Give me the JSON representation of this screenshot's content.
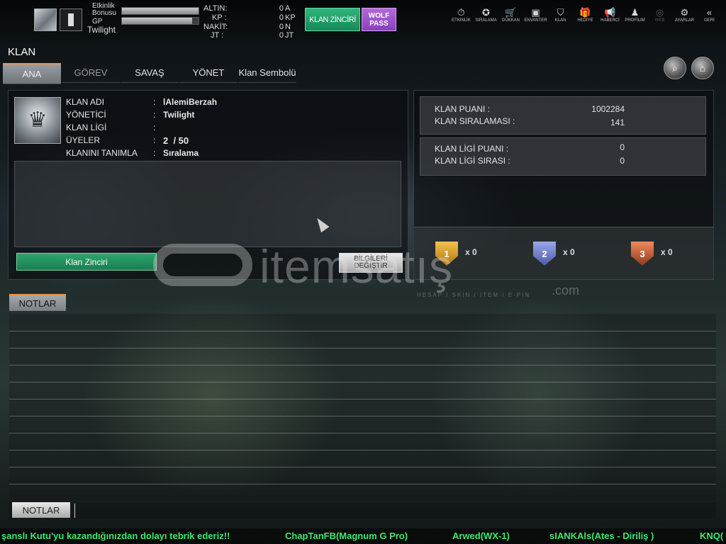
{
  "topbar": {
    "event_bonus_label": "Etkinlik Bonusu",
    "gp_label": "GP",
    "username": "Twilight",
    "event_bonus_progress": 1.0,
    "gp_progress": 0.92,
    "currencies": [
      {
        "label": "ALTIN:",
        "value": "0",
        "unit": "A"
      },
      {
        "label": "KP :",
        "value": "0",
        "unit": "KP"
      },
      {
        "label": "NAKİT:",
        "value": "0",
        "unit": "N"
      },
      {
        "label": "JT :",
        "value": "0",
        "unit": "JT"
      }
    ],
    "clan_chain_button": "KLAN ZİNCİRİ",
    "wolf_pass_button": "WOLF PASS",
    "nav": [
      {
        "label": "ETKİNLİK",
        "icon": "stopwatch-icon",
        "glyph": "⏱"
      },
      {
        "label": "SIRALAMA",
        "icon": "medal-icon",
        "glyph": "✪"
      },
      {
        "label": "DÜKKAN",
        "icon": "cart-icon",
        "glyph": "🛒"
      },
      {
        "label": "ENVANTER",
        "icon": "inventory-icon",
        "glyph": "▣"
      },
      {
        "label": "KLAN",
        "icon": "shield-icon",
        "glyph": "⛉"
      },
      {
        "label": "HEDİYE",
        "icon": "gift-icon",
        "glyph": "🎁"
      },
      {
        "label": "HABERCİ",
        "icon": "megaphone-icon",
        "glyph": "📢"
      },
      {
        "label": "PROFİLIM",
        "icon": "profile-icon",
        "glyph": "♟"
      },
      {
        "label": "WEB",
        "icon": "globe-icon",
        "glyph": "◎"
      },
      {
        "label": "AYARLAR",
        "icon": "gear-icon",
        "glyph": "⚙"
      },
      {
        "label": "GERİ",
        "icon": "back-icon",
        "glyph": "«"
      }
    ]
  },
  "page": {
    "title": "KLAN",
    "tabs": [
      {
        "label": "ANA",
        "state": "active"
      },
      {
        "label": "GÖREV",
        "state": "muted"
      },
      {
        "label": "SAVAŞ",
        "state": "normal"
      },
      {
        "label": "YÖNET",
        "state": "normal"
      },
      {
        "label": "Klan Sembolü",
        "state": "normal"
      }
    ]
  },
  "clan_info": {
    "rows": [
      {
        "key": "KLAN ADI",
        "value": "lAlemiBerzah"
      },
      {
        "key": "YÖNETİCİ",
        "value": "Twilight"
      },
      {
        "key": "KLAN LİGİ",
        "value": ""
      },
      {
        "key": "ÜYELER",
        "value": "2  / 50"
      },
      {
        "key": "KLANINI TANIMLA",
        "value": "Sıralama"
      }
    ],
    "clan_chain_button": "Klan Zinciri",
    "edit_info_button": "BİLGİLERİ DEĞİŞTİR"
  },
  "clan_stats": {
    "box1": [
      {
        "key": "KLAN PUANI :",
        "value": "1002284"
      },
      {
        "key": "KLAN SIRALAMASI :",
        "value": "141"
      }
    ],
    "box2": [
      {
        "key": "KLAN LİGİ PUANI :",
        "value": "0"
      },
      {
        "key": "KLAN LİGİ SIRASI :",
        "value": "0"
      }
    ],
    "medals": [
      {
        "rank": "1",
        "count": "x 0",
        "color": "#f2c14a"
      },
      {
        "rank": "2",
        "count": "x 0",
        "color": "#9aa8e8"
      },
      {
        "rank": "3",
        "count": "x 0",
        "color": "#f08a5a"
      }
    ]
  },
  "watermark": {
    "text": "itemsatış",
    "sub": "HESAP / SKIN / ITEM / E-PIN",
    "com": ".com"
  },
  "notes": {
    "tab_label": "NOTLAR",
    "button_label": "NOTLAR",
    "input_value": ""
  },
  "ticker": [
    "şanslı Kutu'yu kazandığınızdan dolayı tebrik ederiz!!",
    "ChapTanFB(Magnum G Pro)",
    "Arwed(WX-1)",
    "sIANKAls(Ates - Diriliş )",
    "KNQ("
  ],
  "colors": {
    "accent_orange": "#e8914a",
    "clan_chain_green": "#1b8a57",
    "wolf_pass_purple": "#9a4fcc",
    "ticker_green": "#3fe86a"
  }
}
